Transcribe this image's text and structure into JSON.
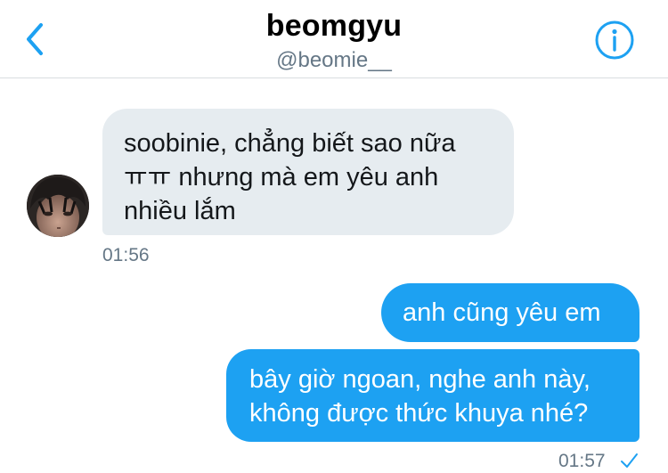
{
  "header": {
    "title": "beomgyu",
    "handle": "@beomie__"
  },
  "icons": {
    "back": "chevron-left-icon",
    "info": "info-circle-icon",
    "read_receipt": "checkmark-icon"
  },
  "colors": {
    "accent": "#1da1f2",
    "received_bubble": "#e6ecf0",
    "secondary_text": "#657786"
  },
  "messages": [
    {
      "direction": "received",
      "lines": [
        "soobinie, chẳng biết sao nữa",
        "ㅠㅠ nhưng mà em yêu anh",
        "nhiều lắm"
      ],
      "time": "01:56"
    },
    {
      "direction": "sent",
      "lines": [
        "anh cũng yêu em"
      ]
    },
    {
      "direction": "sent",
      "lines": [
        "bây giờ ngoan, nghe anh này,",
        "không được thức khuya nhé?"
      ],
      "time": "01:57",
      "read": true
    }
  ]
}
